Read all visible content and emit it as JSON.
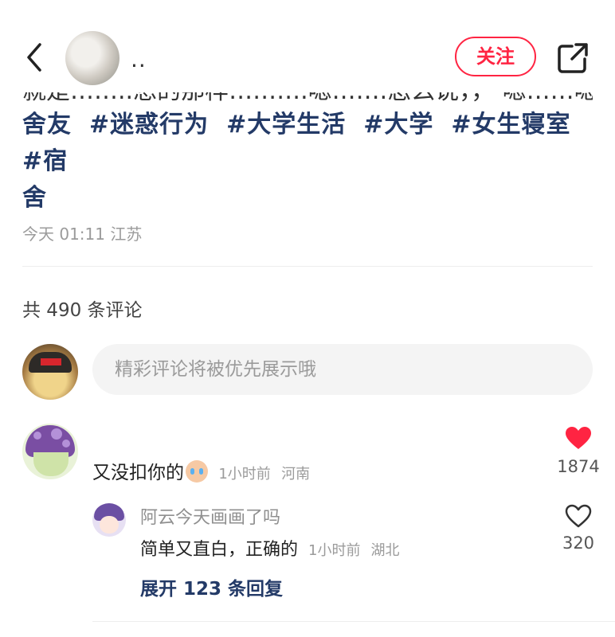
{
  "header": {
    "author_name": "..",
    "follow_label": "关注",
    "back_icon": "chevron-left-icon",
    "share_icon": "share-external-icon"
  },
  "note": {
    "truncated_line": "就是……..想的那样……….嗯…….怎么说，，  嗯……嗯 #",
    "tags": [
      "舍友",
      "#迷惑行为",
      "#大学生活",
      "#大学",
      "#女生寝室",
      "#宿"
    ],
    "tag_tail": "舍",
    "meta": "今天 01:11 江苏"
  },
  "comments_section": {
    "count_label": "共 490 条评论",
    "input_placeholder": "精彩评论将被优先展示哦"
  },
  "comments": [
    {
      "text": "又没扣你的",
      "time": "1小时前",
      "location": "河南",
      "likes": "1874",
      "liked": true,
      "reply": {
        "author": "阿云今天画画了吗",
        "text": "简单又直白，正确的",
        "time": "1小时前",
        "location": "湖北",
        "likes": "320",
        "liked": false
      },
      "expand_label": "展开 123 条回复"
    }
  ],
  "colors": {
    "accent_red": "#ff2442",
    "tag_blue": "#233a67",
    "meta_gray": "#9b9b9b"
  }
}
